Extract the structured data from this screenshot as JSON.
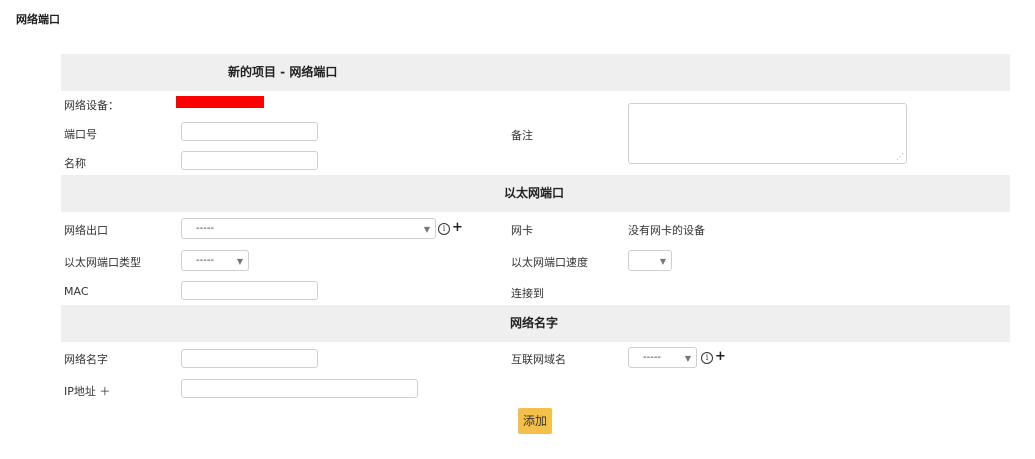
{
  "page": {
    "title": "网络端口"
  },
  "section_general": {
    "title": "新的项目 - 网络端口",
    "device_label": "网络设备：",
    "port_label": "端口号",
    "name_label": "名称",
    "note_label": "备注"
  },
  "section_ethernet": {
    "title": "以太网端口",
    "outlet_label": "网络出口",
    "outlet_value": "-----",
    "nic_label": "网卡",
    "nic_value": "没有网卡的设备",
    "type_label": "以太网端口类型",
    "type_value": "-----",
    "speed_label": "以太网端口速度",
    "speed_value": "",
    "mac_label": "MAC",
    "connected_label": "连接到"
  },
  "section_netname": {
    "title": "网络名字",
    "name_label": "网络名字",
    "domain_label": "互联网域名",
    "domain_value": "-----",
    "ip_label": "IP地址 ＋"
  },
  "actions": {
    "add_label": "添加"
  },
  "icons": {
    "info": "info-circle-icon",
    "plus": "plus-icon",
    "caret": "chevron-down-icon"
  },
  "colors": {
    "add_button": "#f5c04a",
    "band": "#efefef",
    "redaction": "#ff0000"
  }
}
